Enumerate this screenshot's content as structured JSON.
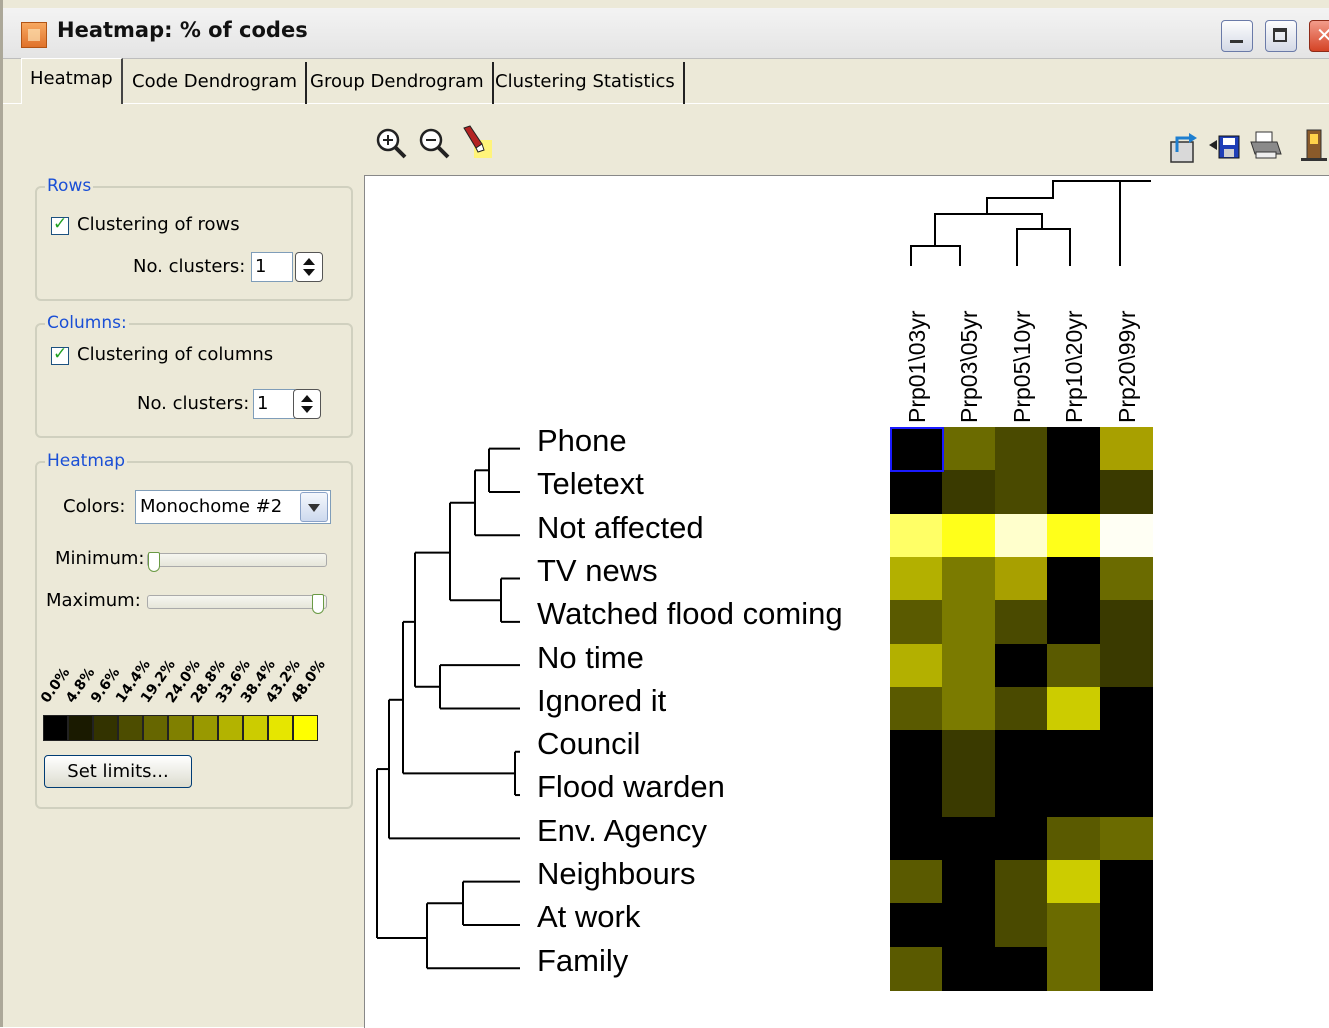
{
  "window": {
    "title": "Heatmap: % of codes"
  },
  "tabs": [
    {
      "label": "Heatmap"
    },
    {
      "label": "Code Dendrogram"
    },
    {
      "label": "Group Dendrogram"
    },
    {
      "label": "Clustering Statistics"
    }
  ],
  "toolbar": {
    "left_icons": [
      "zoom-in-icon",
      "zoom-out-icon",
      "highlighter-icon"
    ],
    "right_icons": [
      "export-icon",
      "save-icon",
      "print-icon",
      "exit-icon"
    ]
  },
  "rows_group": {
    "title": "Rows",
    "checkbox_label": "Clustering of rows",
    "checked": true,
    "clusters_label": "No. clusters:",
    "clusters_value": "1"
  },
  "columns_group": {
    "title": "Columns:",
    "checkbox_label": "Clustering of columns",
    "checked": true,
    "clusters_label": "No. clusters:",
    "clusters_value": "1"
  },
  "heatmap_group": {
    "title": "Heatmap",
    "colors_label": "Colors:",
    "colors_value": "Monochome #2",
    "minimum_label": "Minimum:",
    "maximum_label": "Maximum:",
    "minimum_fraction": 0.0,
    "maximum_fraction": 1.0,
    "scale_labels": [
      "0.0%",
      "4.8%",
      "9.6%",
      "14.4%",
      "19.2%",
      "24.0%",
      "28.8%",
      "33.6%",
      "38.4%",
      "43.2%",
      "48.0%"
    ],
    "scale_colors": [
      "#000000",
      "#1a1a00",
      "#333300",
      "#4d4d00",
      "#666600",
      "#808000",
      "#999900",
      "#b3b300",
      "#cccc00",
      "#e6e600",
      "#ffff00"
    ],
    "set_limits_label": "Set limits..."
  },
  "heatmap": {
    "columns": [
      "Prp01\\03yr",
      "Prp03\\05yr",
      "Prp05\\10yr",
      "Prp10\\20yr",
      "Prp20\\99yr"
    ],
    "rows": [
      "Phone",
      "Teletext",
      "Not affected",
      "TV news",
      "Watched flood coming",
      "No time",
      "Ignored it",
      "Council",
      "Flood warden",
      "Env. Agency",
      "Neighbours",
      "At work",
      "Family"
    ],
    "cells": [
      [
        "#000000",
        "#6b6b00",
        "#4a4a00",
        "#000000",
        "#a8a000"
      ],
      [
        "#000000",
        "#3a3a00",
        "#4a4a00",
        "#000000",
        "#3a3a00"
      ],
      [
        "#ffff66",
        "#ffff1a",
        "#ffffcc",
        "#ffff1a",
        "#fffff4"
      ],
      [
        "#b3b000",
        "#7b7b00",
        "#a8a000",
        "#000000",
        "#6b6b00"
      ],
      [
        "#5a5a00",
        "#7b7b00",
        "#4a4a00",
        "#000000",
        "#3a3a00"
      ],
      [
        "#b3b000",
        "#7b7b00",
        "#000000",
        "#5a5a00",
        "#3a3a00"
      ],
      [
        "#5a5a00",
        "#7b7b00",
        "#4a4a00",
        "#cccc00",
        "#000000"
      ],
      [
        "#000000",
        "#3a3a00",
        "#000000",
        "#000000",
        "#000000"
      ],
      [
        "#000000",
        "#3a3a00",
        "#000000",
        "#000000",
        "#000000"
      ],
      [
        "#000000",
        "#000000",
        "#000000",
        "#5a5a00",
        "#6b6b00"
      ],
      [
        "#5a5a00",
        "#000000",
        "#4a4a00",
        "#cccc00",
        "#000000"
      ],
      [
        "#000000",
        "#000000",
        "#4a4a00",
        "#6b6b00",
        "#000000"
      ],
      [
        "#5a5a00",
        "#000000",
        "#000000",
        "#6b6b00",
        "#000000"
      ]
    ],
    "selected_cell": [
      0,
      0
    ],
    "selection_color": "#1a1aff"
  }
}
